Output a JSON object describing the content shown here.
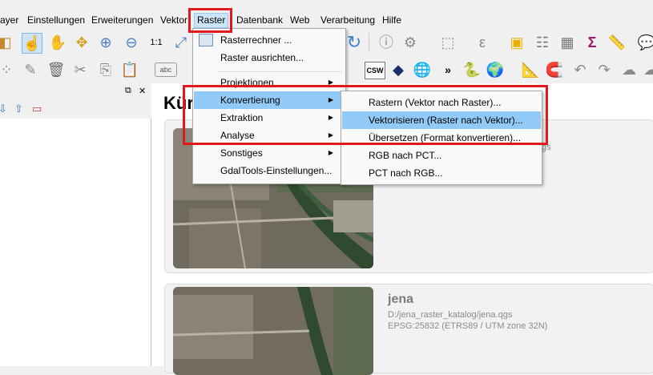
{
  "menubar": {
    "items": [
      "ayer",
      "Einstellungen",
      "Erweiterungen",
      "Vektor",
      "Raster",
      "Datenbank",
      "Web",
      "Verarbeitung",
      "Hilfe"
    ]
  },
  "raster_menu": {
    "items": [
      {
        "label": "Rasterrechner ...",
        "submenu": false
      },
      {
        "label": "Raster ausrichten...",
        "submenu": false
      },
      {
        "label": "Projektionen",
        "submenu": true
      },
      {
        "label": "Konvertierung",
        "submenu": true
      },
      {
        "label": "Extraktion",
        "submenu": true
      },
      {
        "label": "Analyse",
        "submenu": true
      },
      {
        "label": "Sonstiges",
        "submenu": true
      },
      {
        "label": "GdalTools-Einstellungen...",
        "submenu": false
      }
    ]
  },
  "konvertierung_submenu": {
    "items": [
      "Rastern (Vektor nach Raster)...",
      "Vektorisieren (Raster nach Vektor)...",
      "Übersetzen (Format konvertieren)...",
      "RGB nach PCT...",
      "PCT nach RGB..."
    ]
  },
  "toolbar": {
    "csw_label": "CSW",
    "abc_label": "abc",
    "more_label": "»"
  },
  "main": {
    "title_partial": "Kür",
    "card1": {
      "crs_partial": "gs"
    },
    "card2": {
      "name": "jena",
      "path": "D:/jena_raster_katalog/jena.qgs",
      "crs": "EPSG:25832 (ETRS89 / UTM zone 32N)"
    }
  },
  "panel": {
    "float_icon": "⧉",
    "close_icon": "✕"
  },
  "colors": {
    "highlight": "#91c9f7",
    "annotation_red": "#e0191f"
  }
}
